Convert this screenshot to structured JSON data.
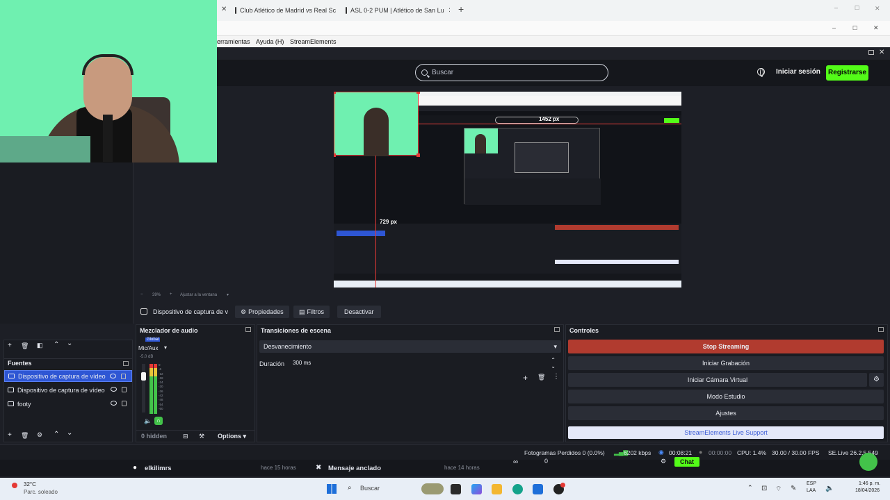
{
  "browser": {
    "tabs": [
      {
        "label": "Club Atlético de Madrid vs Real Sc"
      },
      {
        "label": "ASL 0-2 PUM | Atlético de San Lu"
      }
    ],
    "new_tab": "+",
    "window_controls": {
      "min": "–",
      "max": "☐",
      "close": "✕"
    }
  },
  "obs": {
    "menu": [
      "erramientas",
      "Ayuda (H)",
      "StreamElements"
    ],
    "search_placeholder": "Buscar",
    "login": "Iniciar sesión",
    "register": "Registrarse",
    "zoom": {
      "minus": "−",
      "value": "39%",
      "plus": "+",
      "fit": "Ajustar a la ventana"
    },
    "preview_overlay": {
      "width_label": "1452 px",
      "height_label": "729 px"
    },
    "source_toolbar": {
      "current_source": "Dispositivo de captura de v",
      "properties": "Propiedades",
      "filters": "Filtros",
      "deactivate": "Desactivar"
    },
    "sources": {
      "title": "Fuentes",
      "items": [
        {
          "label": "Dispositivo de captura de vídeo",
          "selected": true
        },
        {
          "label": "Dispositivo de captura de vídeo",
          "selected": false
        },
        {
          "label": "footy",
          "selected": false
        }
      ]
    },
    "mixer": {
      "title": "Mezclador de audio",
      "global": "Global",
      "channel": "Mic/Aux",
      "db": "-5.0 dB",
      "scale": [
        "0",
        "-6",
        "-12",
        "-18",
        "-24",
        "-30",
        "-36",
        "-42",
        "-48",
        "-54",
        "-60"
      ],
      "hidden": "0 hidden",
      "options": "Options"
    },
    "transitions": {
      "title": "Transiciones de escena",
      "selected": "Desvanecimiento",
      "duration_label": "Duración",
      "duration_value": "300 ms"
    },
    "controls": {
      "title": "Controles",
      "stop_streaming": "Stop Streaming",
      "start_recording": "Iniciar Grabación",
      "virtual_camera": "Iniciar Cámara Virtual",
      "studio_mode": "Modo Estudio",
      "settings": "Ajustes",
      "support": "StreamElements Live Support"
    },
    "status": {
      "dropped": "Fotogramas Perdidos 0 (0.0%)",
      "bitrate": "6202 kbps",
      "stream_time": "00:08:21",
      "rec_time": "00:00:00",
      "cpu": "CPU: 1.4%",
      "fps": "30.00 / 30.00 FPS",
      "version": "SE.Live 26.2.5.549"
    }
  },
  "chat": {
    "user": "elkilimrs",
    "user_time": "hace 15 horas",
    "pinned": "Mensaje anclado",
    "pinned_time": "hace 14 horas",
    "count": "0",
    "chat_button": "Chat"
  },
  "taskbar": {
    "weather_temp": "32°C",
    "weather_desc": "Parc. soleado",
    "search": "Buscar",
    "lang_top": "ESP",
    "lang_bottom": "LAA",
    "time": "1:46 p. m.",
    "date": "18/04/2026"
  },
  "colors": {
    "obs_bg": "#1d1f26",
    "stop_red": "#b13b2f",
    "register_green": "#53fc18",
    "selection_blue": "#2e56d4",
    "webcam_green": "#6ff0b0"
  }
}
